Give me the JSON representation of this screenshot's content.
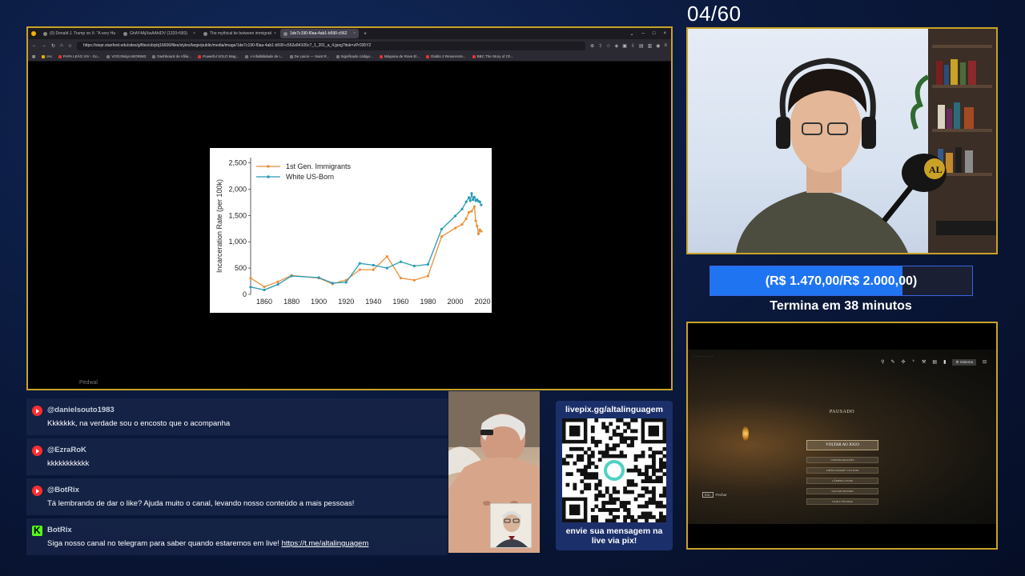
{
  "browser": {
    "tabs": [
      {
        "label": "(0) Donald J. Trump on X: \"A very Ha"
      },
      {
        "label": "GhAY4AjXwAAhIDV (1320×583)"
      },
      {
        "label": "The mythical tie between immigrati"
      },
      {
        "label": "1de7c190-f0aa-4ab1-b590-c562"
      }
    ],
    "active_tab": 3,
    "url": "https://siepr.stanford.edu/sites/g/files/sbiybj16606/files/styles/large/public/media/image/1de7c190-f0aa-4ab1-b590-c562e84105c7_1_201_a_4.jpeg?itok=zPr035Y2",
    "bookmarks": [
      {
        "label": "IAs"
      },
      {
        "label": "PAPA LEÃO XIV - Go..."
      },
      {
        "label": "VOOJNinja MIORIM3"
      },
      {
        "label": "Dashboard de Afilia..."
      },
      {
        "label": "Powerful SOLO Mag..."
      },
      {
        "label": "A infalibilidade de I..."
      },
      {
        "label": "De Laicis — Saint R..."
      },
      {
        "label": "Significado código..."
      },
      {
        "label": "Máquina de Rove El..."
      },
      {
        "label": "Diablo 2 Resurrecte..."
      },
      {
        "label": "BBC The Story of Ch..."
      }
    ],
    "cut_label": "Pedwal"
  },
  "chart_data": {
    "type": "line",
    "ylabel": "Incarceration Rate (per 100k)",
    "xlabel": "",
    "xlim": [
      1850,
      2022
    ],
    "ylim": [
      0,
      2600
    ],
    "x_ticks": [
      1860,
      1880,
      1900,
      1920,
      1940,
      1960,
      1980,
      2000,
      2020
    ],
    "y_ticks": [
      0,
      500,
      1000,
      1500,
      2000,
      2500
    ],
    "y_tick_labels": [
      "0",
      "500",
      "1,000",
      "1,500",
      "2,000",
      "2,500"
    ],
    "legend_position": "top-left",
    "grid": false,
    "series": [
      {
        "name": "1st Gen. Immigrants",
        "color": "#e8913a",
        "x": [
          1850,
          1860,
          1870,
          1880,
          1900,
          1910,
          1920,
          1930,
          1940,
          1950,
          1960,
          1970,
          1980,
          1990,
          2000,
          2005,
          2008,
          2010,
          2012,
          2014,
          2015,
          2016,
          2017,
          2018,
          2019
        ],
        "y": [
          310,
          145,
          240,
          360,
          310,
          200,
          270,
          470,
          470,
          720,
          310,
          270,
          350,
          1100,
          1260,
          1330,
          1440,
          1560,
          1580,
          1670,
          1400,
          1300,
          1150,
          1230,
          1200
        ]
      },
      {
        "name": "White US-Born",
        "color": "#2a9bb5",
        "x": [
          1850,
          1860,
          1870,
          1880,
          1900,
          1910,
          1920,
          1930,
          1940,
          1950,
          1960,
          1970,
          1980,
          1990,
          2000,
          2005,
          2008,
          2010,
          2011,
          2012,
          2013,
          2014,
          2015,
          2016,
          2017,
          2018,
          2019
        ],
        "y": [
          140,
          85,
          190,
          350,
          320,
          215,
          230,
          590,
          555,
          500,
          620,
          540,
          570,
          1240,
          1490,
          1620,
          1760,
          1840,
          1780,
          1920,
          1800,
          1850,
          1780,
          1800,
          1770,
          1760,
          1700
        ]
      }
    ]
  },
  "stream": {
    "counter": "04/60",
    "goal": {
      "label": "(R$ 1.470,00/R$ 2.000,00)",
      "progress": 0.735,
      "subtext": "Termina em 38 minutos"
    }
  },
  "game": {
    "pause_title": "PAUSADO",
    "system_label": "Sistema",
    "menu": [
      {
        "label": "VOLTAR AO JOGO",
        "primary": true
      },
      {
        "label": "CONFIGURAÇÕES"
      },
      {
        "label": "DIFICULDADE: CUSTOM"
      },
      {
        "label": "CÂMERA LIVRE"
      },
      {
        "label": "SALVAR MUNDO"
      },
      {
        "label": "SAIR E FECHAR"
      }
    ],
    "back_hint": "Fechar"
  },
  "chat": [
    {
      "platform": "youtube",
      "user": "@danielsouto1983",
      "text": "Kkkkkkk, na verdade sou o encosto que o acompanha"
    },
    {
      "platform": "youtube",
      "user": "@EzraRoK",
      "text": "kkkkkkkkkkk"
    },
    {
      "platform": "youtube",
      "user": "@BotRix",
      "text": "Tá lembrando de dar o like? Ajuda muito o canal, levando nosso conteúdo a mais pessoas!"
    },
    {
      "platform": "kick",
      "user": "BotRix",
      "text": "Siga nosso canal no telegram para saber quando estaremos em live!",
      "link": "https://t.me/altalinguagem"
    }
  ],
  "livepix": {
    "url": "livepix.gg/altalinguagem",
    "message_line1": "envie sua mensagem na",
    "message_line2": "live via pix!"
  }
}
